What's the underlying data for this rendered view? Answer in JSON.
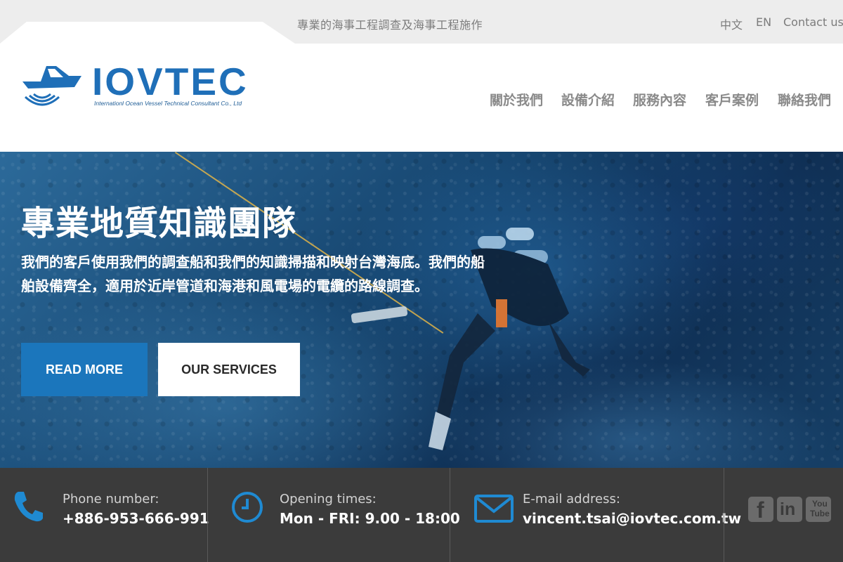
{
  "topbar": {
    "tagline": "專業的海事工程調查及海事工程施作",
    "lang_zh": "中文",
    "lang_en": "EN",
    "contact": "Contact us"
  },
  "logo": {
    "name": "IOVTEC",
    "subtitle": "Internationl Ocean Vessel Technical Consultant Co., Ltd"
  },
  "nav": {
    "items": [
      "關於我們",
      "設備介紹",
      "服務內容",
      "客戶案例",
      "聯絡我們"
    ]
  },
  "hero": {
    "title": "專業地質知識團隊",
    "text": "我們的客戶使用我們的調查船和我們的知識掃描和映射台灣海底。我們的船舶設備齊全，適用於近岸管道和海港和風電場的電纜的路線調查。",
    "read_more": "READ MORE",
    "our_services": "OUR SERVICES"
  },
  "info": {
    "phone_label": "Phone number:",
    "phone_value": "+886-953-666-991",
    "hours_label": "Opening times:",
    "hours_value": "Mon - FRI: 9.00 - 18:00",
    "email_label": "E-mail address:",
    "email_value": "vincent.tsai@iovtec.com.tw"
  },
  "social": {
    "icons": [
      "facebook-icon",
      "linkedin-icon",
      "youtube-icon"
    ]
  },
  "colors": {
    "brand_blue": "#1b76bc",
    "infobar_bg": "#3b3b3b",
    "icon_blue": "#1f8ad2"
  }
}
